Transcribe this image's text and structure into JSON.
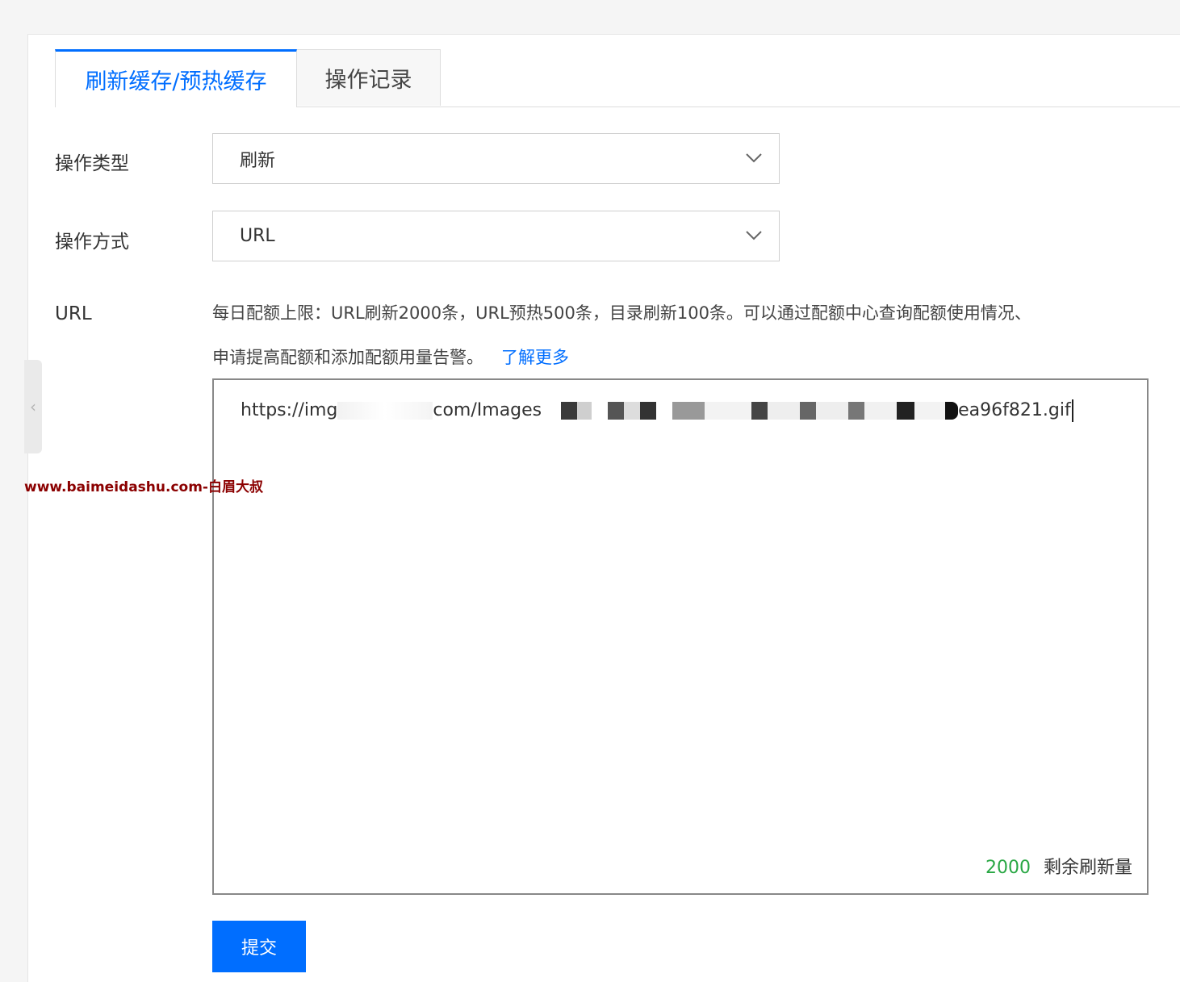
{
  "tabs": [
    {
      "label": "刷新缓存/预热缓存",
      "active": true
    },
    {
      "label": "操作记录",
      "active": false
    }
  ],
  "form": {
    "operation_type": {
      "label": "操作类型",
      "value": "刷新"
    },
    "operation_method": {
      "label": "操作方式",
      "value": "URL"
    },
    "url": {
      "label": "URL",
      "hint_line1": "每日配额上限：URL刷新2000条，URL预热500条，目录刷新100条。可以通过配额中心查询配额使用情况、",
      "hint_line2": "申请提高配额和添加配额用量告警。",
      "learn_more": "了解更多",
      "value_prefix": "https://img",
      "value_middle": "com/Images",
      "value_suffix": "ea96f821.gif",
      "remaining_count": "2000",
      "remaining_label": "剩余刷新量"
    },
    "submit_label": "提交"
  },
  "watermark": "www.baimeidashu.com-白眉大叔",
  "colors": {
    "accent": "#006eff",
    "counter": "#29a744",
    "watermark": "#8b0000"
  }
}
